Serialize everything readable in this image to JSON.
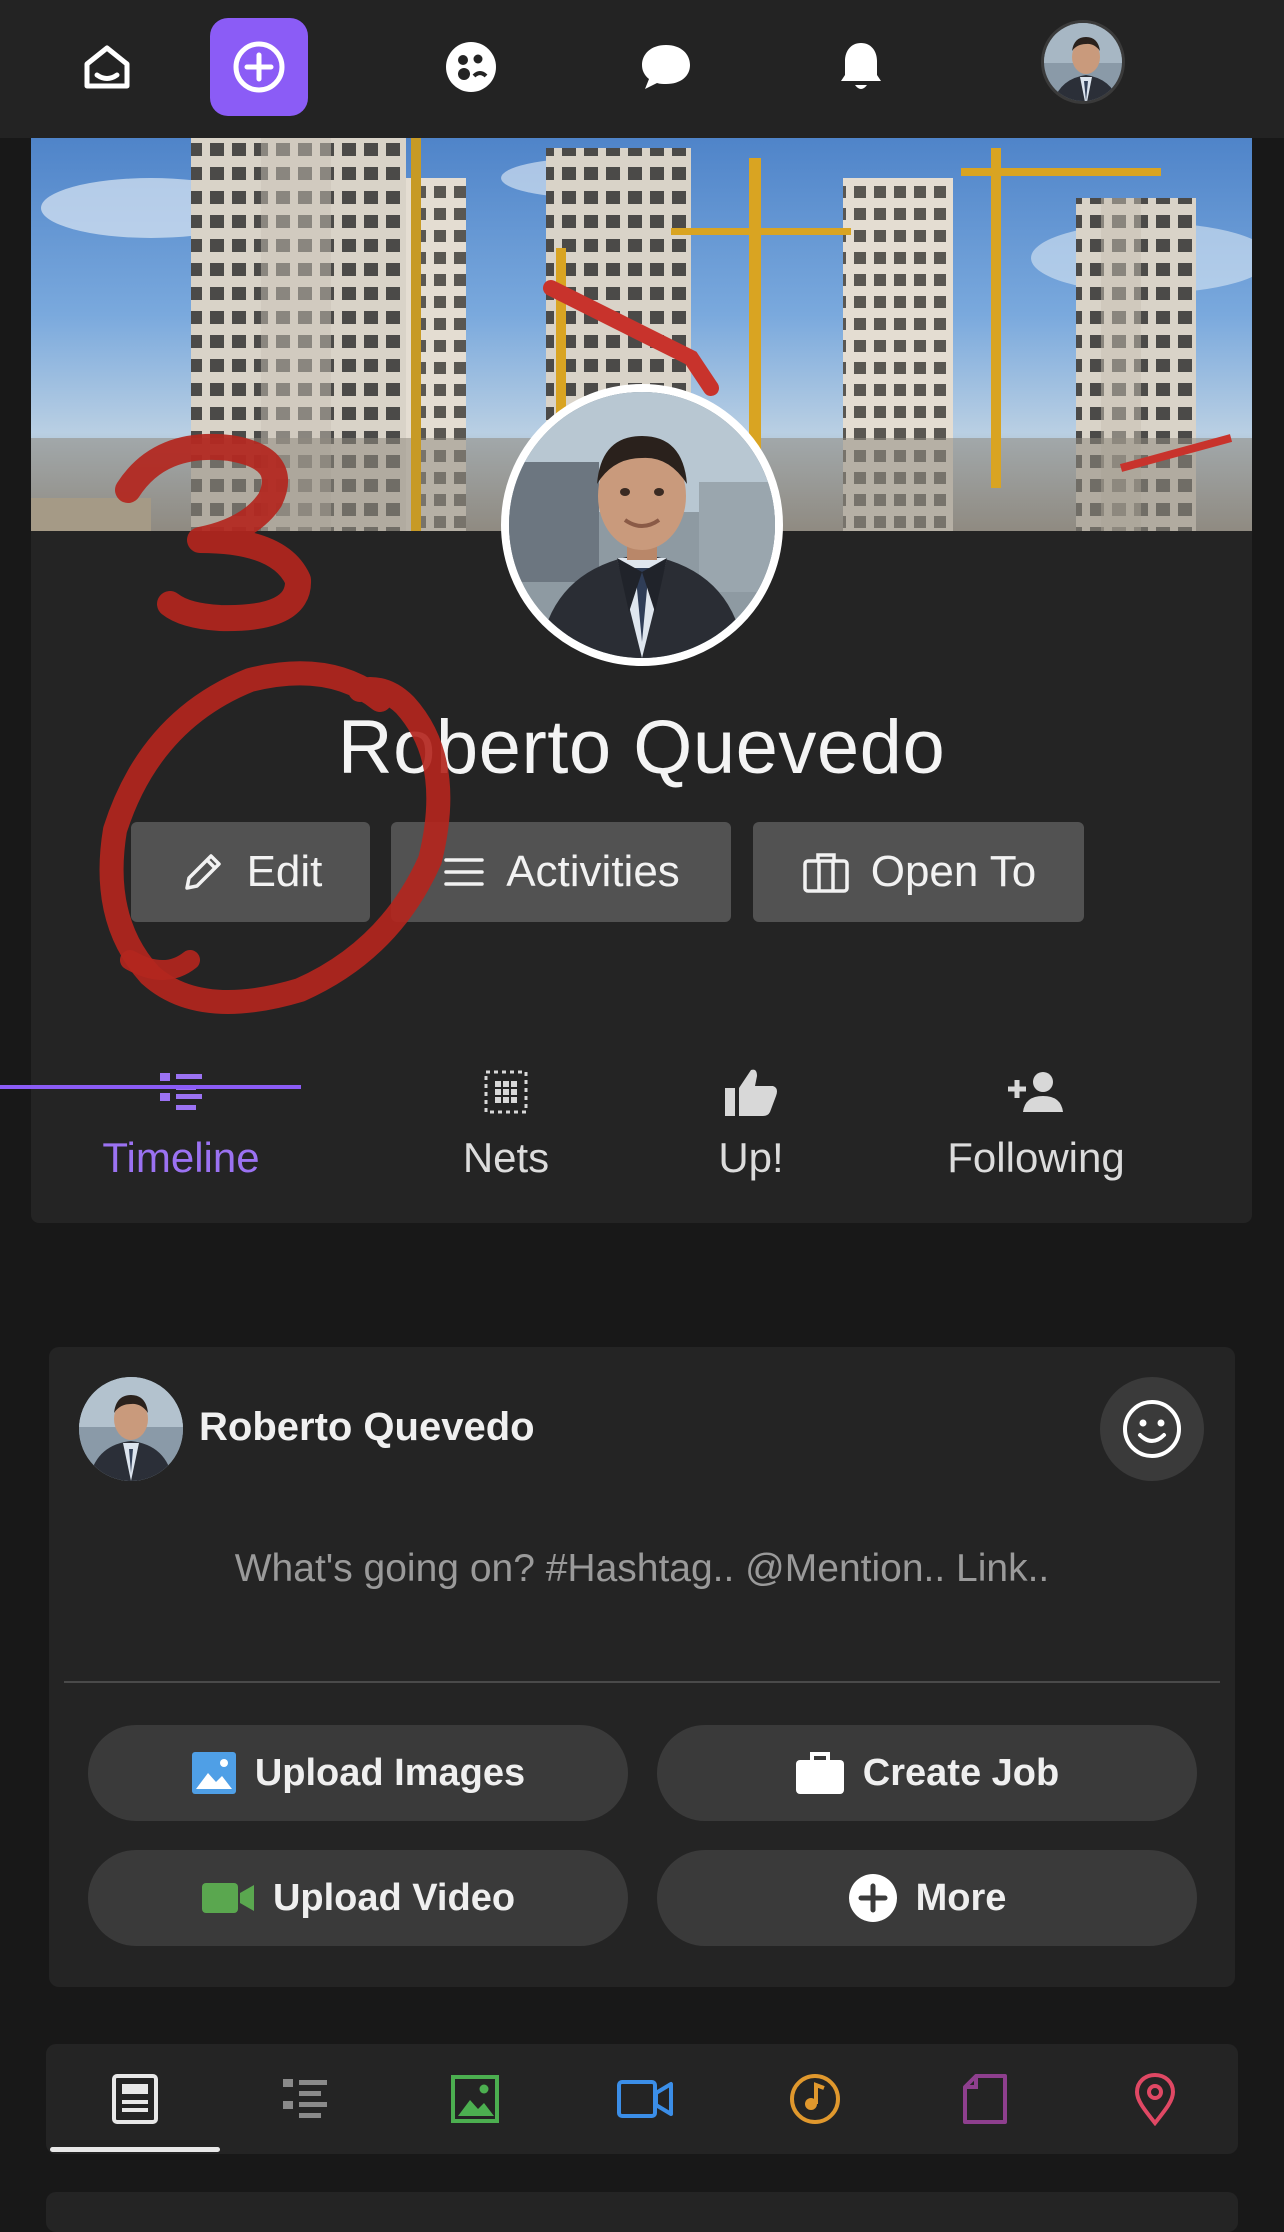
{
  "topnav": {
    "items": [
      {
        "icon": "home-icon"
      },
      {
        "icon": "add-circle-icon",
        "active": true
      },
      {
        "icon": "community-icon"
      },
      {
        "icon": "chat-bubble-icon"
      },
      {
        "icon": "bell-icon"
      },
      {
        "icon": "avatar"
      }
    ],
    "accent": "#8b5cf6"
  },
  "profile": {
    "name": "Roberto Quevedo",
    "actions": {
      "edit": "Edit",
      "activities": "Activities",
      "open_to": "Open To"
    },
    "tabs": [
      {
        "label": "Timeline",
        "icon": "timeline-icon",
        "active": true
      },
      {
        "label": "Nets",
        "icon": "grid-icon"
      },
      {
        "label": "Up!",
        "icon": "thumbs-up-icon"
      },
      {
        "label": "Following",
        "icon": "person-add-icon"
      }
    ]
  },
  "annotation": {
    "text": "3",
    "color": "#b3261e"
  },
  "composer": {
    "user_name": "Roberto Quevedo",
    "placeholder": "What's going on? #Hashtag.. @Mention.. Link..",
    "buttons": {
      "upload_images": "Upload Images",
      "create_job": "Create Job",
      "upload_video": "Upload Video",
      "more": "More"
    }
  },
  "content_types": [
    {
      "icon": "post-icon",
      "color": "#e8e8e8",
      "active": true
    },
    {
      "icon": "list-icon",
      "color": "#8a8a8a"
    },
    {
      "icon": "image-icon",
      "color": "#4caf50"
    },
    {
      "icon": "video-icon",
      "color": "#3b8ee8"
    },
    {
      "icon": "audio-icon",
      "color": "#e0982d"
    },
    {
      "icon": "file-icon",
      "color": "#8e3f8e"
    },
    {
      "icon": "location-icon",
      "color": "#e04864"
    }
  ]
}
